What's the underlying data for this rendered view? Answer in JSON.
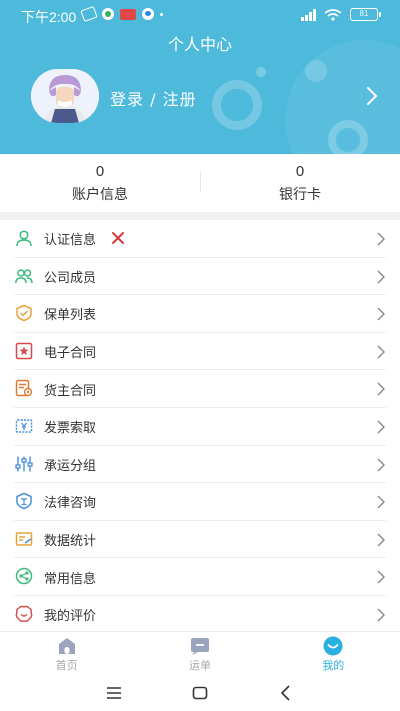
{
  "status_bar": {
    "time": "下午2:00",
    "battery": "81"
  },
  "header": {
    "title": "个人中心",
    "login_text": "登录 / 注册"
  },
  "stats": [
    {
      "value": "0",
      "label": "账户信息"
    },
    {
      "value": "0",
      "label": "银行卡"
    }
  ],
  "menu": [
    {
      "label": "认证信息",
      "icon": "user-icon",
      "color": "#3dbb7c"
    },
    {
      "label": "公司成员",
      "icon": "users-icon",
      "color": "#3dbb7c"
    },
    {
      "label": "保单列表",
      "icon": "shield-check-icon",
      "color": "#e8a33a"
    },
    {
      "label": "电子合同",
      "icon": "contract-stamp-icon",
      "color": "#d84a4a"
    },
    {
      "label": "货主合同",
      "icon": "document-eye-icon",
      "color": "#e07a30"
    },
    {
      "label": "发票索取",
      "icon": "invoice-icon",
      "color": "#4a8fd8"
    },
    {
      "label": "承运分组",
      "icon": "sliders-icon",
      "color": "#4a8fd8"
    },
    {
      "label": "法律咨询",
      "icon": "law-shield-icon",
      "color": "#4a8fd8"
    },
    {
      "label": "数据统计",
      "icon": "chart-card-icon",
      "color": "#e8a33a"
    },
    {
      "label": "常用信息",
      "icon": "share-icon",
      "color": "#3dbb7c"
    },
    {
      "label": "我的评价",
      "icon": "review-icon",
      "color": "#d84a4a"
    }
  ],
  "tabs": [
    {
      "label": "首页",
      "icon": "home-icon"
    },
    {
      "label": "运单",
      "icon": "waybill-icon"
    },
    {
      "label": "我的",
      "icon": "profile-icon",
      "active": true
    }
  ],
  "colors": {
    "header_bg": "#4db9db",
    "accent": "#2ab0e0",
    "error_x": "#d83a3a"
  }
}
